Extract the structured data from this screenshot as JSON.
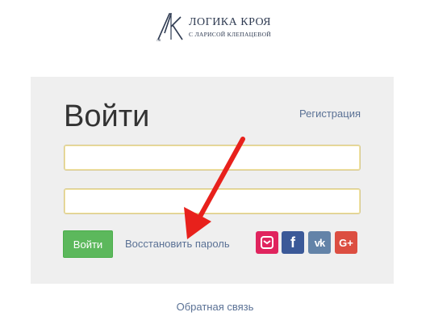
{
  "logo": {
    "monogram": "ЛК",
    "title": "ЛОГИКА КРОЯ",
    "subtitle": "С ЛАРИСОЙ КЛЕПАЦЕВОЙ"
  },
  "form": {
    "heading": "Войти",
    "register_link": "Регистрация",
    "login_button": "Войти",
    "restore_link": "Восстановить пароль",
    "username_value": "",
    "password_value": ""
  },
  "social": [
    {
      "icon": "gmail-icon",
      "glyph": "G",
      "color": "#e0245e"
    },
    {
      "icon": "facebook-icon",
      "glyph": "f",
      "color": "#3b5998"
    },
    {
      "icon": "vk-icon",
      "glyph": "vk",
      "color": "#6383a8"
    },
    {
      "icon": "google-plus-icon",
      "glyph": "G+",
      "color": "#dc4e41"
    }
  ],
  "footer": {
    "feedback_link": "Обратная связь"
  },
  "colors": {
    "accent_link": "#5a7195",
    "login_button": "#5cb85c",
    "panel": "#efefef",
    "annotation_arrow": "#e8211c"
  }
}
